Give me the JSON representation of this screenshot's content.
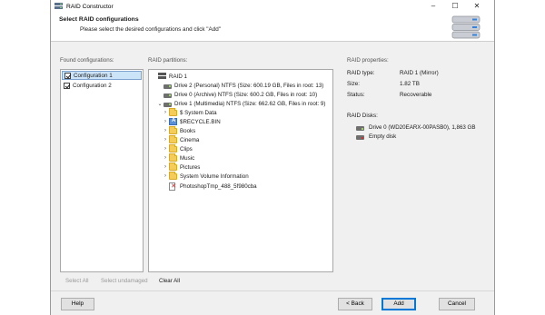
{
  "window": {
    "title": "RAID Constructor",
    "min_icon": "minimize-icon",
    "max_icon": "maximize-icon",
    "close_icon": "close-icon"
  },
  "header": {
    "title": "Select RAID configurations",
    "subtitle": "Please select the desired configurations and click \"Add\""
  },
  "found": {
    "label": "Found configurations:",
    "items": [
      {
        "label": "Configuration 1",
        "checked": true,
        "selected": true
      },
      {
        "label": "Configuration 2",
        "checked": true,
        "selected": false
      }
    ]
  },
  "partitions": {
    "label": "RAID partitions:",
    "nodes": [
      {
        "label": "RAID 1",
        "icon": "raid-icon",
        "expander": ""
      },
      {
        "label": "Drive 2 (Personal) NTFS (Size: 600.19 GB, Files in root: 13)",
        "icon": "drive-icon",
        "expander": ""
      },
      {
        "label": "Drive 0 (Archive) NTFS (Size: 600.2 GB, Files in root: 10)",
        "icon": "drive-icon",
        "expander": ""
      },
      {
        "label": "Drive 1 (Multimedia) NTFS (Size: 662.62 GB, Files in root: 9)",
        "icon": "drive-icon",
        "expander": "⌄"
      },
      {
        "label": "$ System Data",
        "icon": "folder-icon",
        "expander": "›"
      },
      {
        "label": "$RECYCLE.BIN",
        "icon": "system-folder-icon",
        "expander": "›"
      },
      {
        "label": "Books",
        "icon": "folder-icon",
        "expander": "›"
      },
      {
        "label": "Cinema",
        "icon": "folder-icon",
        "expander": "›"
      },
      {
        "label": "Clips",
        "icon": "folder-icon",
        "expander": "›"
      },
      {
        "label": "Music",
        "icon": "folder-icon",
        "expander": "›"
      },
      {
        "label": "Pictures",
        "icon": "folder-icon",
        "expander": "›"
      },
      {
        "label": "System Volume Information",
        "icon": "folder-icon",
        "expander": "›"
      },
      {
        "label": "PhotoshopTmp_488_5f980cba",
        "icon": "deleted-file-icon",
        "expander": ""
      }
    ]
  },
  "properties": {
    "label": "RAID properties:",
    "type_label": "RAID type:",
    "type_value": "RAID 1 (Mirror)",
    "size_label": "Size:",
    "size_value": "1.82 TB",
    "status_label": "Status:",
    "status_value": "Recoverable",
    "disks_label": "RAID Disks:",
    "disks": [
      {
        "label": "Drive 0 (WD20EARX-00PASB0), 1,863 GB",
        "status": "ok"
      },
      {
        "label": "Empty disk",
        "status": "empty"
      }
    ]
  },
  "selection": {
    "select_all": "Select All",
    "select_undamaged": "Select undamaged",
    "clear_all": "Clear All"
  },
  "buttons": {
    "help": "Help",
    "back": "< Back",
    "add": "Add",
    "cancel": "Cancel"
  },
  "colors": {
    "selection": "#cce4f7",
    "folder": "#f3cc5a",
    "accent": "#0078d7"
  }
}
